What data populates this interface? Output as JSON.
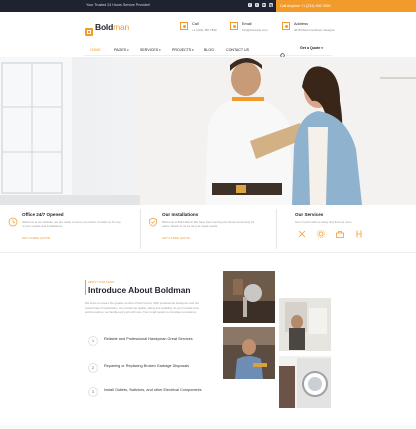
{
  "topbar": {
    "tagline": "Your Trusted 24 Hours Service Provider!",
    "socials": [
      "f",
      "t",
      "in",
      "ig"
    ],
    "call_text": "Call Anytime  +1 (234) 456 7890"
  },
  "header": {
    "logo": {
      "brand": "Bold",
      "brand_accent": "man"
    },
    "contacts": [
      {
        "title": "Call",
        "value": "+1 (234) 456 7890"
      },
      {
        "title": "Email",
        "value": "info@example.com"
      },
      {
        "title": "Address",
        "value": "4578 Marmora Road, Glasgow"
      }
    ]
  },
  "nav": {
    "items": [
      "HOME",
      "PAGES",
      "SERVICES",
      "PROJECTS",
      "BLOG",
      "CONTACT US"
    ],
    "quote_label": "Get a Quote"
  },
  "features": [
    {
      "title": "Office 24/7 Opened",
      "desc": "Welcome to our website, we are ready to serve you better. Contact us for any of your repairs and installations.",
      "link": "GET A FREE QUOTE"
    },
    {
      "title": "Our Installations",
      "desc": "Welcome to Bold Man's! We have been serving the Great community for years. Reach to us for all your repair needs.",
      "link": "GET A FREE QUOTE"
    },
    {
      "title": "Our Services",
      "desc": "Get in touch with us today and find out more.",
      "service_icons": [
        "tools-icon",
        "gear-icon",
        "toolbox-icon",
        "wrench-icon"
      ]
    }
  ],
  "about": {
    "kicker": "ABOUT OUR TEAM",
    "heading": "Introduce About Boldman",
    "paragraph": "We strive to ensure the greater comfort of their homes. With professional handymen and the trusted help of technicians, we provide top quality, safety and reliability. As your trusted local service partner, we handle every job with care, from small repairs to complete renovations.",
    "steps": [
      {
        "num": "1",
        "text": "Reliable and Professional Handyman Great Services"
      },
      {
        "num": "2",
        "text": "Repairing or Replacing Broken Garbage Disposals"
      },
      {
        "num": "3",
        "text": "Install Outlets, Switches, and other Electrical Components"
      }
    ]
  },
  "colors": {
    "accent": "#f39b2a",
    "dark": "#1f2230"
  }
}
